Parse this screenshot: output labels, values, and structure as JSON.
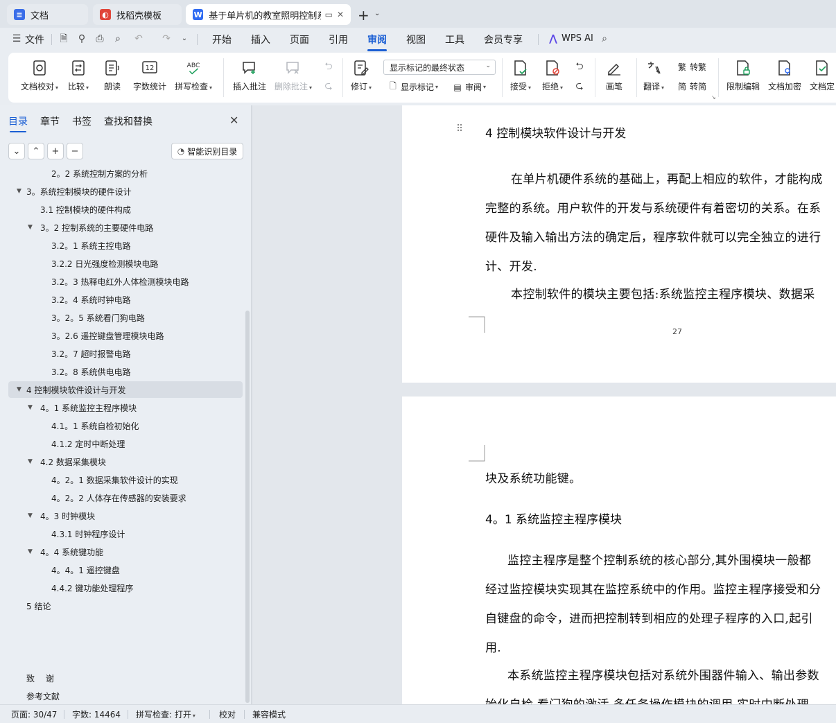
{
  "tabs": [
    {
      "label": "文档",
      "icon": "docs-icon",
      "color": "#3b6ee8"
    },
    {
      "label": "找稻壳模板",
      "icon": "docer-icon",
      "color": "#e0463a"
    },
    {
      "label": "基于单片机的教室照明控制系",
      "icon": "word-icon",
      "color": "#2f6bf2"
    }
  ],
  "menu": {
    "file": "文件",
    "items": [
      "开始",
      "插入",
      "页面",
      "引用",
      "审阅",
      "视图",
      "工具",
      "会员专享"
    ],
    "active": "审阅",
    "wps_ai": "WPS AI"
  },
  "ribbon": {
    "doc_check": "文档校对",
    "compare": "比较",
    "read_aloud": "朗读",
    "word_count": "字数统计",
    "spell_check": "拼写检查",
    "insert_comment": "插入批注",
    "delete_comment": "删除批注",
    "revise": "修订",
    "display_mode": "显示标记的最终状态",
    "show_markup": "显示标记",
    "review": "审阅",
    "accept": "接受",
    "reject": "拒绝",
    "pen": "画笔",
    "translate": "翻译",
    "to_traditional": "转繁",
    "to_simplified": "转简",
    "restrict_edit": "限制编辑",
    "doc_encrypt": "文档加密",
    "doc_final": "文档定",
    "abc_label": "ABC",
    "count_label": "12"
  },
  "nav": {
    "tabs": [
      "目录",
      "章节",
      "书签",
      "查找和替换"
    ],
    "active_tab": "目录",
    "smart_toc": "智能识别目录",
    "toc": [
      {
        "label": "2。2 系统控制方案的分析",
        "indent": 2,
        "arrow": false
      },
      {
        "label": "3。系统控制模块的硬件设计",
        "indent": 0,
        "arrow": true
      },
      {
        "label": "3.1 控制模块的硬件构成",
        "indent": 1,
        "arrow": false
      },
      {
        "label": "3。2 控制系统的主要硬件电路",
        "indent": 1,
        "arrow": true
      },
      {
        "label": "3.2。1 系统主控电路",
        "indent": 2,
        "arrow": false
      },
      {
        "label": "3.2.2 日光强度检测模块电路",
        "indent": 2,
        "arrow": false
      },
      {
        "label": "3.2。3 热释电红外人体检测模块电路",
        "indent": 2,
        "arrow": false
      },
      {
        "label": "3.2。4 系统时钟电路",
        "indent": 2,
        "arrow": false
      },
      {
        "label": "3。2。5 系统看门狗电路",
        "indent": 2,
        "arrow": false
      },
      {
        "label": "3。2.6 遥控键盘管理模块电路",
        "indent": 2,
        "arrow": false
      },
      {
        "label": "3.2。7 超时报警电路",
        "indent": 2,
        "arrow": false
      },
      {
        "label": "3.2。8 系统供电电路",
        "indent": 2,
        "arrow": false
      },
      {
        "label": "4 控制模块软件设计与开发",
        "indent": 0,
        "arrow": true,
        "selected": true
      },
      {
        "label": "4。1 系统监控主程序模块",
        "indent": 1,
        "arrow": true
      },
      {
        "label": "4.1。1 系统自检初始化",
        "indent": 2,
        "arrow": false
      },
      {
        "label": "4.1.2 定时中断处理",
        "indent": 2,
        "arrow": false
      },
      {
        "label": "4.2 数据采集模块",
        "indent": 1,
        "arrow": true
      },
      {
        "label": "4。2。1 数据采集软件设计的实现",
        "indent": 2,
        "arrow": false
      },
      {
        "label": "4。2。2 人体存在传感器的安装要求",
        "indent": 2,
        "arrow": false
      },
      {
        "label": "4。3 时钟模块",
        "indent": 1,
        "arrow": true
      },
      {
        "label": "4.3.1 时钟程序设计",
        "indent": 2,
        "arrow": false
      },
      {
        "label": "4。4 系统键功能",
        "indent": 1,
        "arrow": true
      },
      {
        "label": "4。4。1 遥控键盘",
        "indent": 2,
        "arrow": false
      },
      {
        "label": "4.4.2 键功能处理程序",
        "indent": 2,
        "arrow": false
      },
      {
        "label": "5 结论",
        "indent": 0,
        "arrow": false
      },
      {
        "label": "致　 谢",
        "indent": 0,
        "arrow": false,
        "gap": true
      },
      {
        "label": "参考文献",
        "indent": 0,
        "arrow": false
      }
    ]
  },
  "document": {
    "page1": {
      "heading": "4  控制模块软件设计与开发",
      "lines": [
        "在单片机硬件系统的基础上，再配上相应的软件，才能构成",
        "完整的系统。用户软件的开发与系统硬件有着密切的关系。在系",
        "硬件及输入输出方法的确定后，程序软件就可以完全独立的进行",
        "计、开发.",
        "本控制软件的模块主要包括:系统监控主程序模块、数据采"
      ],
      "page_number": "27"
    },
    "page2": {
      "first_line": "块及系统功能键。",
      "heading": "4。1  系统监控主程序模块",
      "lines": [
        "监控主程序是整个控制系统的核心部分,其外围模块一般都",
        "经过监控模块实现其在监控系统中的作用。监控主程序接受和分",
        "自键盘的命令，进而把控制转到相应的处理子程序的入口,起引",
        "用.",
        "本系统监控主程序模块包括对系统外围器件输入、输出参数",
        "始化自检 看门狗的激活 多任务操作模块的调用  实时中断处理"
      ]
    }
  },
  "status": {
    "page": "页面: 30/47",
    "words": "字数: 14464",
    "spell": "拼写检查: 打开",
    "proof": "校对",
    "compat": "兼容模式"
  }
}
